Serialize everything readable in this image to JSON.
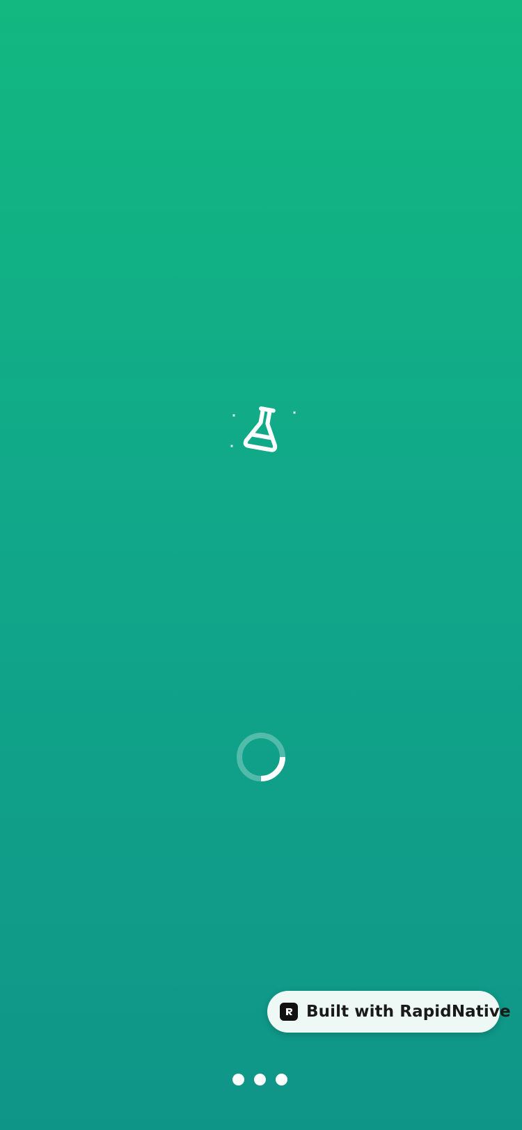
{
  "splash": {
    "logo_icon": "flask-icon",
    "loading_indicator_icon": "spinner-icon",
    "background_colors": {
      "top": "#12b880",
      "bottom": "#0f9588"
    }
  },
  "badge": {
    "label": "Built with RapidNative",
    "icon": "rapidnative-logo-icon"
  },
  "page_indicator": {
    "count": 3
  }
}
